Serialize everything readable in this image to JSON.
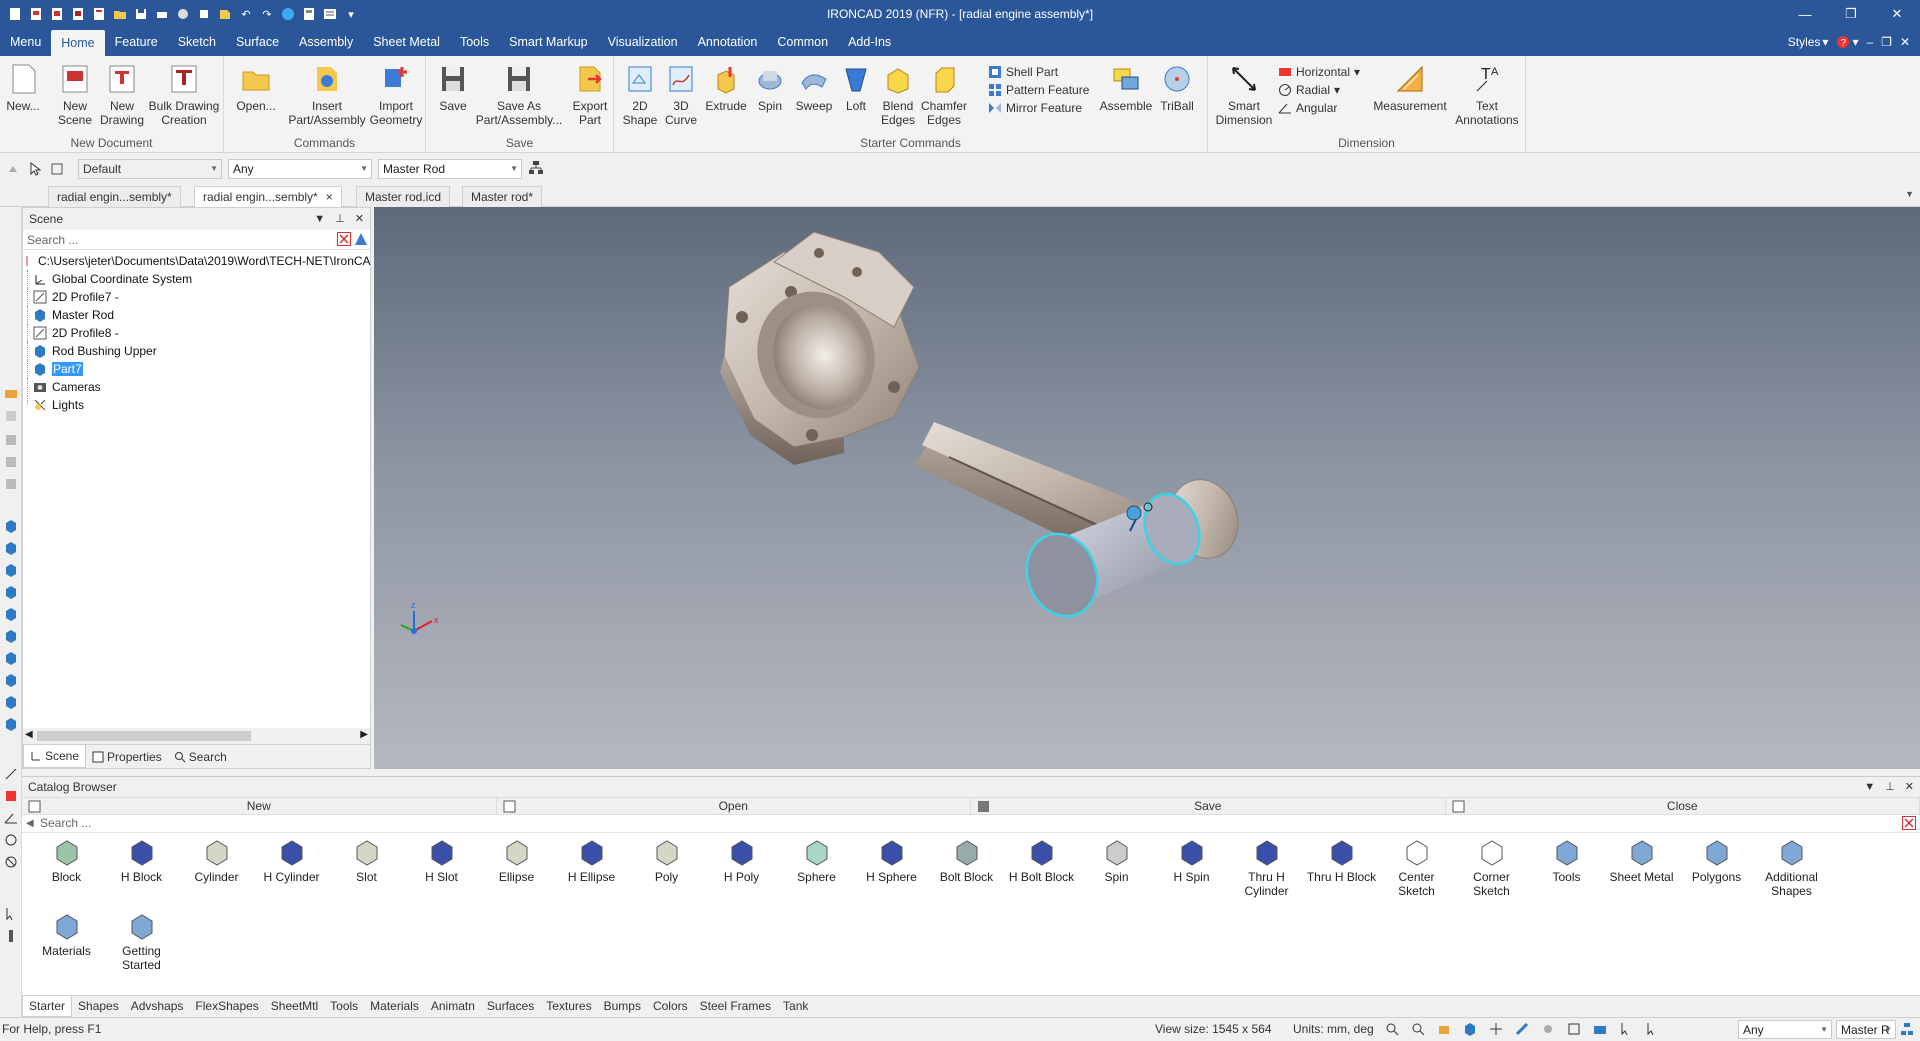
{
  "window": {
    "title": "IRONCAD 2019 (NFR) - [radial engine assembly*]",
    "controls": [
      "minimize",
      "restore",
      "close"
    ]
  },
  "ribbon_tabs": [
    "Menu",
    "Home",
    "Feature",
    "Sketch",
    "Surface",
    "Assembly",
    "Sheet Metal",
    "Tools",
    "Smart Markup",
    "Visualization",
    "Annotation",
    "Common",
    "Add-Ins"
  ],
  "active_tab": "Home",
  "ribbon_right": {
    "styles": "Styles"
  },
  "ribbon": {
    "new_document": {
      "label": "New Document",
      "new": "New...",
      "new_scene": [
        "New",
        "Scene"
      ],
      "new_drawing": [
        "New",
        "Drawing"
      ],
      "bulk_drawing": [
        "Bulk Drawing",
        "Creation"
      ]
    },
    "commands": {
      "label": "Commands",
      "open": "Open...",
      "insert": [
        "Insert",
        "Part/Assembly"
      ],
      "import": [
        "Import",
        "Geometry"
      ]
    },
    "save": {
      "label": "Save",
      "save": "Save",
      "save_as": [
        "Save As",
        "Part/Assembly..."
      ],
      "export": [
        "Export",
        "Part"
      ]
    },
    "starter": {
      "label": "Starter Commands",
      "shape2d": [
        "2D",
        "Shape"
      ],
      "curve3d": [
        "3D",
        "Curve"
      ],
      "extrude": "Extrude",
      "spin": "Spin",
      "sweep": "Sweep",
      "loft": "Loft",
      "blend": [
        "Blend",
        "Edges"
      ],
      "chamfer": [
        "Chamfer",
        "Edges"
      ],
      "shell": "Shell Part",
      "pattern": "Pattern Feature",
      "mirror": "Mirror Feature",
      "assemble": "Assemble",
      "triball": "TriBall"
    },
    "dimension": {
      "label": "Dimension",
      "smart": [
        "Smart",
        "Dimension"
      ],
      "horizontal": "Horizontal",
      "radial": "Radial",
      "angular": "Angular",
      "measurement": "Measurement",
      "text": [
        "Text",
        "Annotations"
      ]
    }
  },
  "selection_toolbar": {
    "style_combo": "Default",
    "filter_combo": "Any",
    "part_combo": "Master Rod"
  },
  "doc_tabs": [
    {
      "label": "radial engin...sembly*",
      "active": false
    },
    {
      "label": "radial engin...sembly*",
      "active": true,
      "close": "×"
    },
    {
      "label": "Master rod.icd",
      "active": false
    },
    {
      "label": "Master rod*",
      "active": false
    }
  ],
  "scene_panel": {
    "title": "Scene",
    "search_placeholder": "Search ...",
    "path": "C:\\Users\\jeter\\Documents\\Data\\2019\\Word\\TECH-NET\\IronCA",
    "tree": [
      {
        "label": "Global Coordinate System",
        "icon": "coordinate-system-icon"
      },
      {
        "label": "2D Profile7 -",
        "icon": "profile-icon"
      },
      {
        "label": "Master Rod",
        "icon": "part-icon"
      },
      {
        "label": "2D Profile8 -",
        "icon": "profile-icon"
      },
      {
        "label": "Rod Bushing Upper",
        "icon": "part-icon"
      },
      {
        "label": "Part7",
        "icon": "part-icon",
        "selected": true
      },
      {
        "label": "Cameras",
        "icon": "camera-icon"
      },
      {
        "label": "Lights",
        "icon": "light-icon"
      }
    ],
    "tabs": [
      "Scene",
      "Properties",
      "Search"
    ]
  },
  "viewport": {
    "triad_labels": {
      "x": "x",
      "z": "z"
    }
  },
  "catalog": {
    "title": "Catalog Browser",
    "toolbar": [
      "New",
      "Open",
      "Save",
      "Close"
    ],
    "search_placeholder": "Search ...",
    "items": [
      "Block",
      "H Block",
      "Cylinder",
      "H Cylinder",
      "Slot",
      "H Slot",
      "Ellipse",
      "H Ellipse",
      "Poly",
      "H Poly",
      "Sphere",
      "H Sphere",
      "Bolt Block",
      "H Bolt Block",
      "Spin",
      "H Spin",
      "Thru H|Cylinder",
      "Thru H Block",
      "Center|Sketch",
      "Corner|Sketch",
      "Tools",
      "Sheet Metal",
      "Polygons",
      "Additional|Shapes",
      "Materials",
      "Getting|Started"
    ],
    "tabs": [
      "Starter",
      "Shapes",
      "Advshaps",
      "FlexShapes",
      "SheetMtl",
      "Tools",
      "Materials",
      "Animatn",
      "Surfaces",
      "Textures",
      "Bumps",
      "Colors",
      "Steel Frames",
      "Tank"
    ]
  },
  "status": {
    "help": "For Help, press F1",
    "view_size": "View size: 1545 x  564",
    "units": "Units: mm, deg",
    "filter": "Any",
    "part": "Master R"
  },
  "colors": {
    "title_bar": "#2b579a",
    "selection_highlight": "#3399ff",
    "viewport_top": "#5d6a7a",
    "viewport_bottom": "#b6b8bf",
    "rod_metal": "#c9bfb5",
    "pin_edge": "#39d4e8"
  }
}
